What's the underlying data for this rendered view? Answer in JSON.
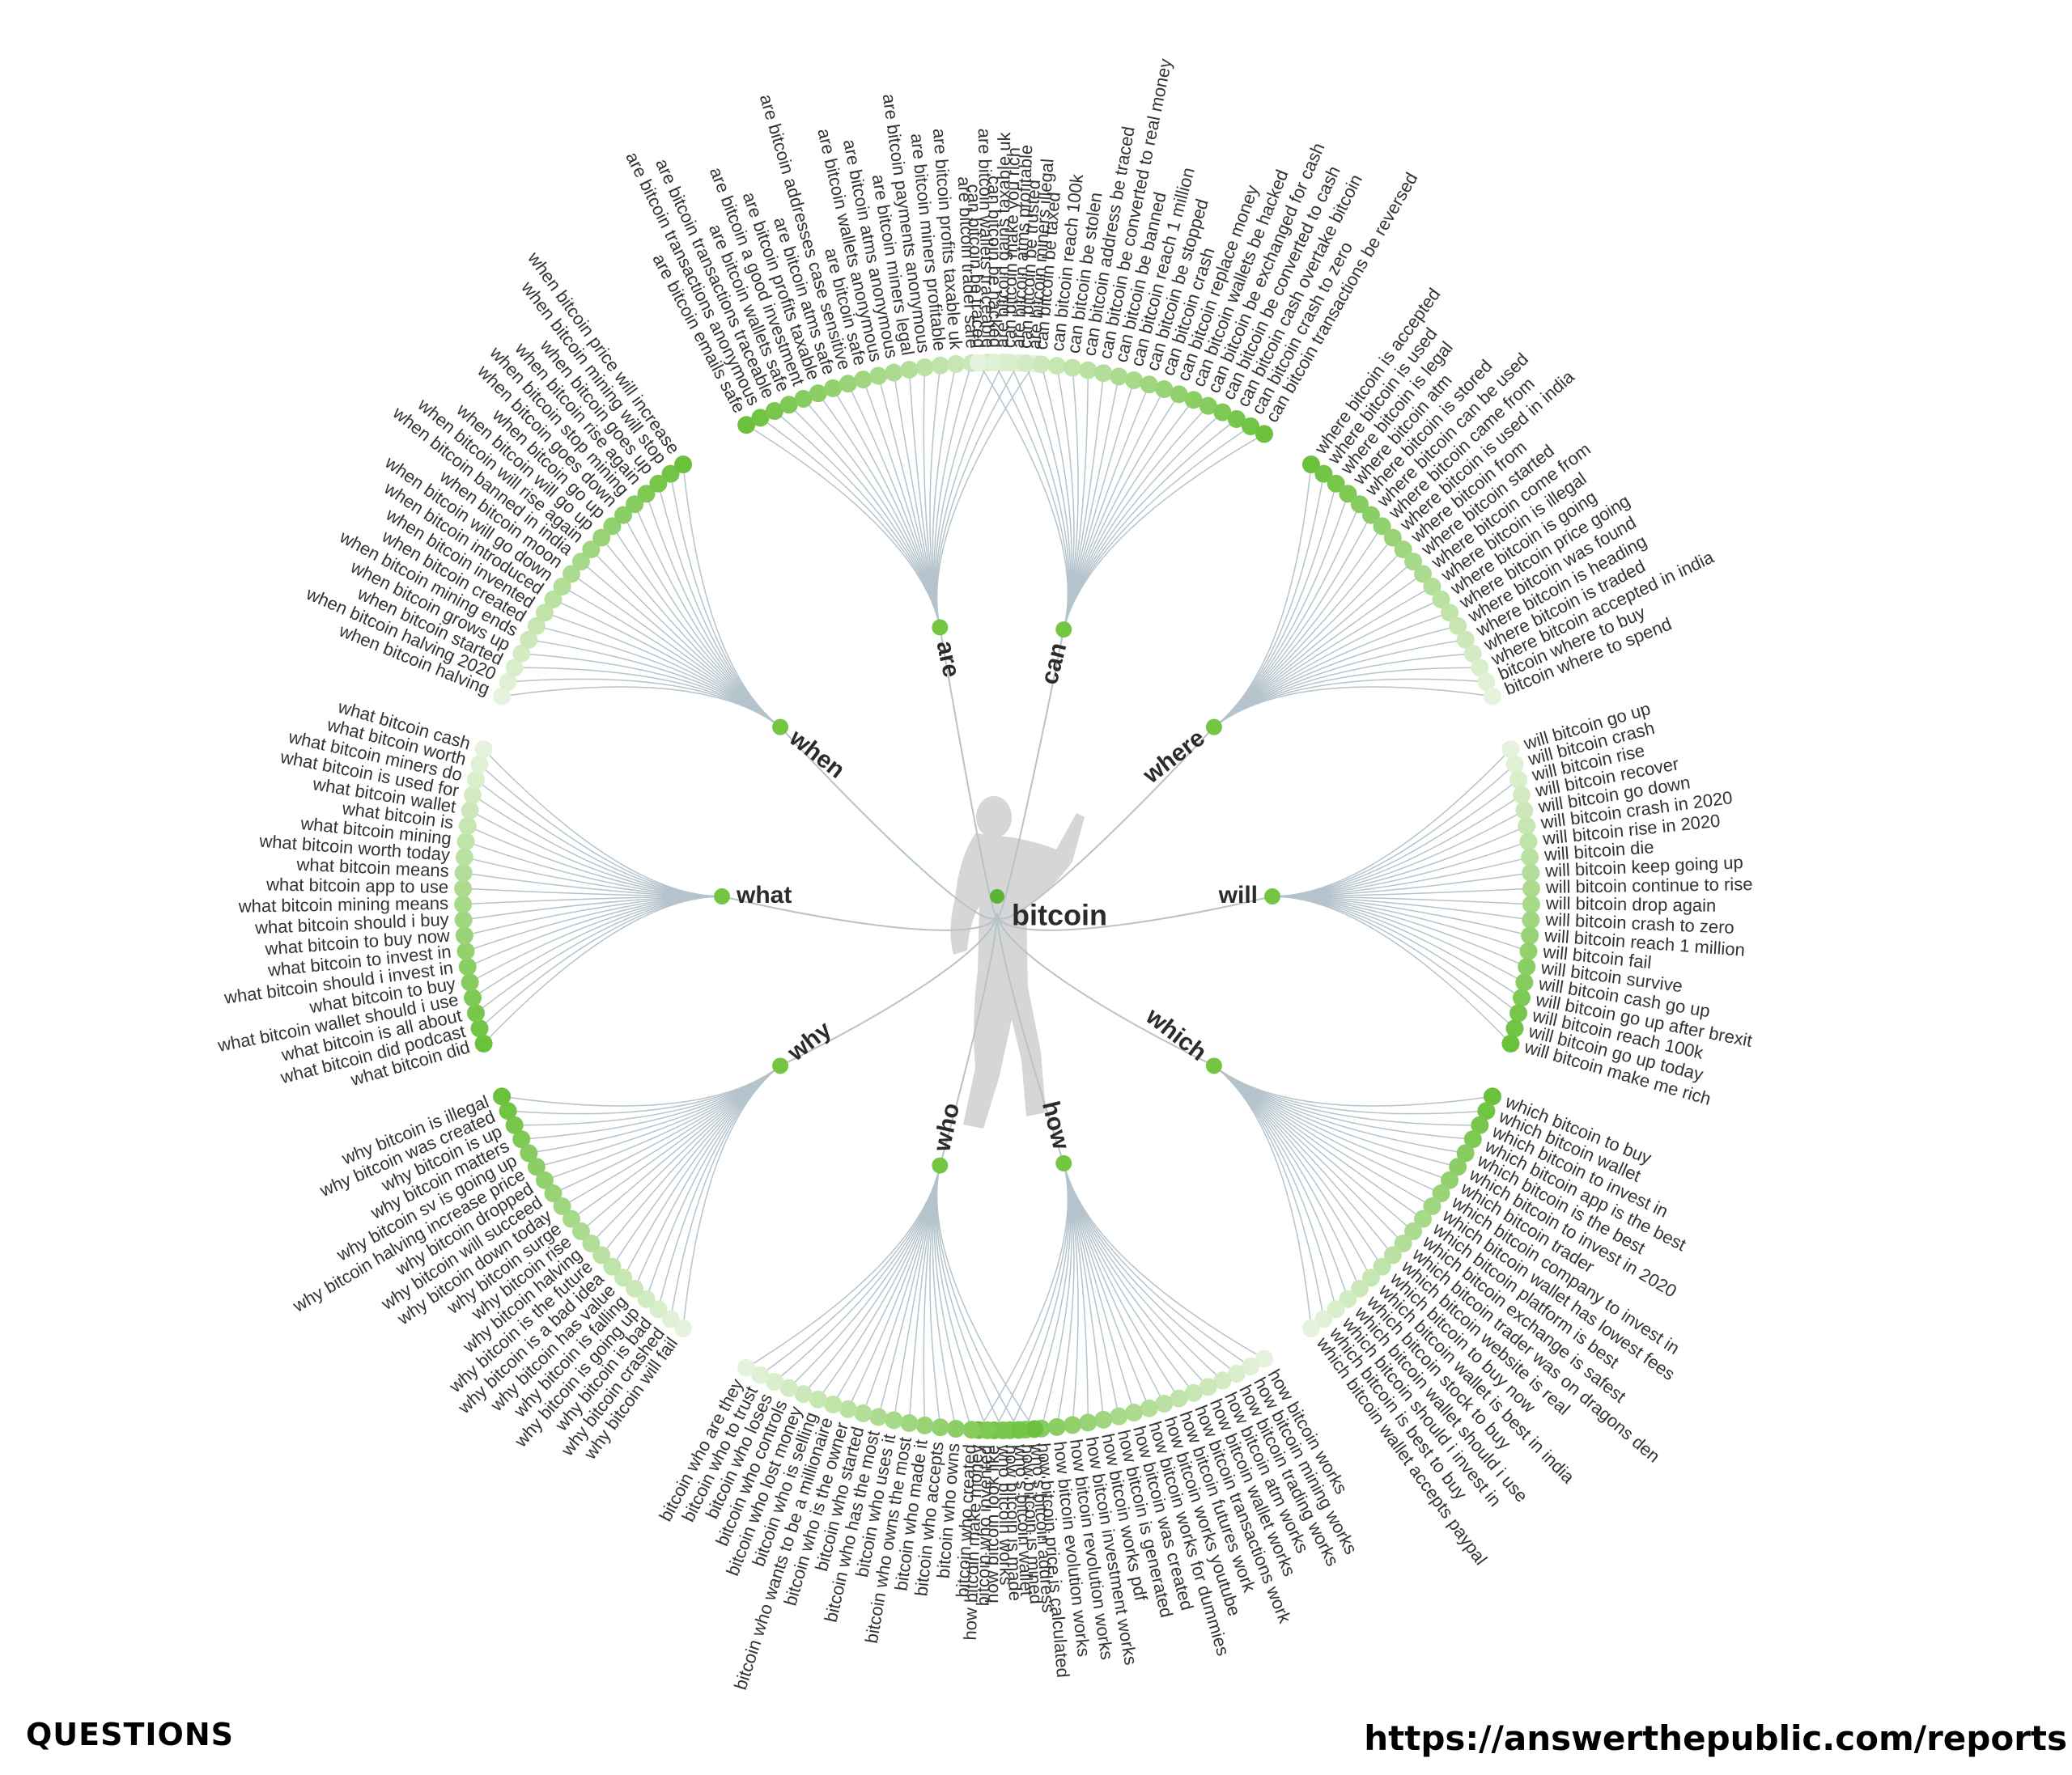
{
  "root": {
    "label": "bitcoin"
  },
  "colors": {
    "dot_dark": "#6cc13c",
    "dot_light": "#e6f3dc",
    "link": "#b5c3cc",
    "text": "#333333",
    "silhouette": "#c8c8c8"
  },
  "branches": [
    {
      "label": "are",
      "items": [
        "are bitcoin emails safe",
        "are bitcoin transactions anonymous",
        "are bitcoin transactions traceable",
        "are bitcoin wallets safe",
        "are bitcoin a good investment",
        "are bitcoin profits taxable",
        "are bitcoin atms safe",
        "are bitcoin addresses case sensitive",
        "are bitcoin safe",
        "are bitcoin wallets anonymous",
        "are bitcoin atms anonymous",
        "are bitcoin miners legal",
        "are bitcoin payments anonymous",
        "are bitcoin miners profitable",
        "are bitcoin profits taxable uk",
        "are bitcoin trader safe",
        "are bitcoin wallets traceable",
        "are bitcoin gains taxable uk",
        "are bitcoin atms profitable",
        "are bitcoin miners illegal"
      ]
    },
    {
      "label": "can",
      "items": [
        "can bitcoin be traced",
        "can bitcoin be hacked",
        "can bitcoin make you rich",
        "can bitcoin be trusted",
        "can bitcoin be taxed",
        "can bitcoin reach 100k",
        "can bitcoin be stolen",
        "can bitcoin address be traced",
        "can bitcoin be converted to real money",
        "can bitcoin be banned",
        "can bitcoin reach 1 million",
        "can bitcoin be stopped",
        "can bitcoin crash",
        "can bitcoin replace money",
        "can bitcoin wallets be hacked",
        "can bitcoin be exchanged for cash",
        "can bitcoin be converted to cash",
        "can bitcoin cash overtake bitcoin",
        "can bitcoin crash to zero",
        "can bitcoin transactions be reversed"
      ]
    },
    {
      "label": "where",
      "items": [
        "where bitcoin is accepted",
        "where bitcoin is used",
        "where bitcoin is legal",
        "where bitcoin atm",
        "where bitcoin is stored",
        "where bitcoin can be used",
        "where bitcoin came from",
        "where bitcoin is used in india",
        "where bitcoin from",
        "where bitcoin started",
        "where bitcoin come from",
        "where bitcoin is illegal",
        "where bitcoin is going",
        "where bitcoin price going",
        "where bitcoin was found",
        "where bitcoin is heading",
        "where bitcoin is traded",
        "where bitcoin accepted in india",
        "bitcoin where to buy",
        "bitcoin where to spend"
      ]
    },
    {
      "label": "will",
      "items": [
        "will bitcoin go up",
        "will bitcoin crash",
        "will bitcoin rise",
        "will bitcoin recover",
        "will bitcoin go down",
        "will bitcoin crash in 2020",
        "will bitcoin rise in 2020",
        "will bitcoin die",
        "will bitcoin keep going up",
        "will bitcoin continue to rise",
        "will bitcoin drop again",
        "will bitcoin crash to zero",
        "will bitcoin reach 1 million",
        "will bitcoin fail",
        "will bitcoin survive",
        "will bitcoin cash go up",
        "will bitcoin go up after brexit",
        "will bitcoin reach 100k",
        "will bitcoin go up today",
        "will bitcoin make me rich"
      ]
    },
    {
      "label": "which",
      "items": [
        "which bitcoin to buy",
        "which bitcoin wallet",
        "which bitcoin to invest in",
        "which bitcoin app is the best",
        "which bitcoin is the best",
        "which bitcoin to invest in 2020",
        "which bitcoin trader",
        "which bitcoin company to invest in",
        "which bitcoin wallet has lowest fees",
        "which bitcoin platform is best",
        "which bitcoin exchange is safest",
        "which bitcoin trader was on dragons den",
        "which bitcoin website is real",
        "which bitcoin to buy now",
        "which bitcoin wallet is best in india",
        "which bitcoin stock to buy",
        "which bitcoin wallet should i use",
        "which bitcoin should i invest in",
        "which bitcoin is best to buy",
        "which bitcoin wallet accepts paypal"
      ]
    },
    {
      "label": "how",
      "items": [
        "how bitcoin works",
        "how bitcoin mining works",
        "how bitcoin trading works",
        "how bitcoin atm works",
        "how bitcoin wallet works",
        "how bitcoin transactions work",
        "how bitcoin futures work",
        "how bitcoin works youtube",
        "how bitcoin works for dummies",
        "how bitcoin was created",
        "how bitcoin is generated",
        "how bitcoin works pdf",
        "how bitcoin investment works",
        "how bitcoin revolution works",
        "how bitcoin evolution works",
        "how bitcoin price is calculated",
        "how bitcoin is mined",
        "how bitcoin is made",
        "how bitcoin look like",
        "how bitcoin make money"
      ]
    },
    {
      "label": "who",
      "items": [
        "who's bitcoin address",
        "who's bitcoin wallet",
        "who bitcoin works",
        "bitcoin who invented",
        "bitcoin who created",
        "bitcoin who owns",
        "bitcoin who accepts",
        "bitcoin who made it",
        "bitcoin who owns the most",
        "bitcoin who uses it",
        "bitcoin who has the most",
        "bitcoin who started",
        "bitcoin who is the owner",
        "bitcoin who wants to be a millionaire",
        "bitcoin who is selling",
        "bitcoin who lost money",
        "bitcoin who controls",
        "bitcoin who loses",
        "bitcoin who to trust",
        "bitcoin who are they"
      ]
    },
    {
      "label": "why",
      "items": [
        "why bitcoin will fail",
        "why bitcoin crashed",
        "why bitcoin is bad",
        "why bitcoin is going up",
        "why bitcoin is falling",
        "why bitcoin has value",
        "why bitcoin is a bad idea",
        "why bitcoin is the future",
        "why bitcoin halving",
        "why bitcoin rise",
        "why bitcoin surge",
        "why bitcoin down today",
        "why bitcoin will succeed",
        "why bitcoin dropped",
        "why bitcoin halving increase price",
        "why bitcoin sv is going up",
        "why bitcoin matters",
        "why bitcoin is up",
        "why bitcoin was created",
        "why bitcoin is illegal"
      ]
    },
    {
      "label": "what",
      "items": [
        "what bitcoin did",
        "what bitcoin did podcast",
        "what bitcoin is all about",
        "what bitcoin wallet should i use",
        "what bitcoin to buy",
        "what bitcoin should i invest in",
        "what bitcoin to invest in",
        "what bitcoin to buy now",
        "what bitcoin should i buy",
        "what bitcoin mining means",
        "what bitcoin app to use",
        "what bitcoin means",
        "what bitcoin worth today",
        "what bitcoin mining",
        "what bitcoin is",
        "what bitcoin wallet",
        "what bitcoin is used for",
        "what bitcoin miners do",
        "what bitcoin worth",
        "what bitcoin cash"
      ]
    },
    {
      "label": "when",
      "items": [
        "when bitcoin halving",
        "when bitcoin halving 2020",
        "when bitcoin started",
        "when bitcoin grows up",
        "when bitcoin mining ends",
        "when bitcoin created",
        "when bitcoin invented",
        "when bitcoin introduced",
        "when bitcoin will go down",
        "when bitcoin moon",
        "when bitcoin banned in india",
        "when bitcoin will rise again",
        "when bitcoin will go up",
        "when bitcoin go up",
        "when bitcoin goes down",
        "when bitcoin stop mining",
        "when bitcoin rise again",
        "when bitcoin goes up",
        "when bitcoin mining will stop",
        "when bitcoin price will increase"
      ]
    }
  ],
  "footer": {
    "left": "QUESTIONS",
    "right": "https://answerthepublic.com/reports"
  }
}
